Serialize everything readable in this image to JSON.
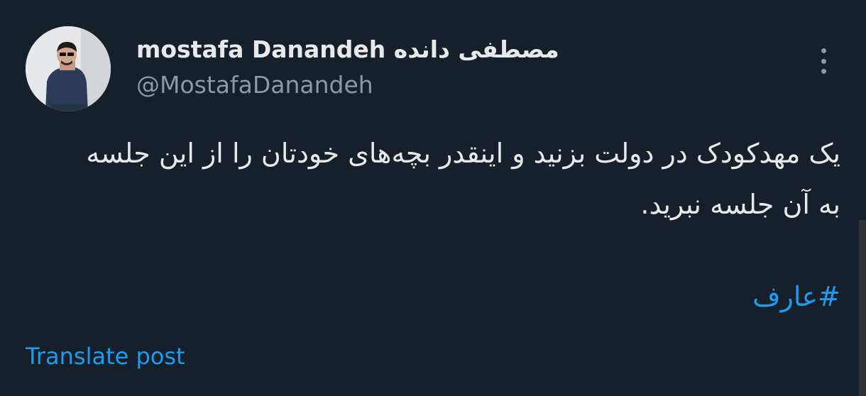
{
  "post": {
    "author": {
      "display_name": "mostafa Danandeh مصطفی دانده",
      "handle": "@MostafaDanandeh"
    },
    "body_text": "یک مهدکودک در دولت بزنید و اینقدر بچه‌های خودتان را از این جلسه به آن جلسه نبرید.",
    "hashtag": "#عارف",
    "translate_label": "Translate post"
  },
  "colors": {
    "background": "#15202b",
    "primary_text": "#e7e9ea",
    "secondary_text": "#8b98a5",
    "link": "#1d9bf0"
  },
  "icons": {
    "more": "more-vertical-icon"
  }
}
